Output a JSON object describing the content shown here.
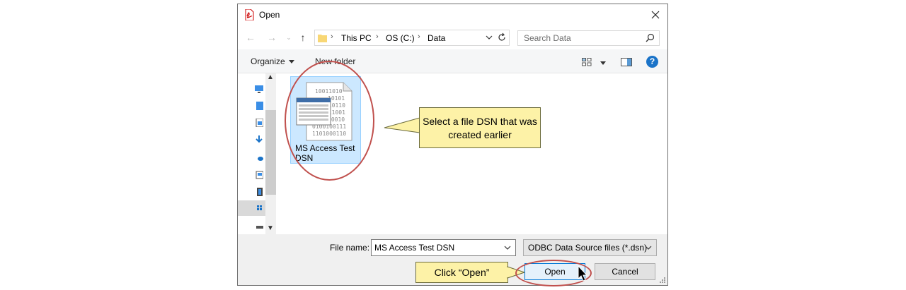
{
  "window": {
    "title": "Open"
  },
  "address": {
    "crumbs": [
      "This PC",
      "OS (C:)",
      "Data"
    ]
  },
  "search": {
    "placeholder": "Search Data"
  },
  "toolbar": {
    "organize_label": "Organize",
    "new_folder_label": "New folder"
  },
  "files": [
    {
      "name": "MS Access Test DSN",
      "type": "file DSN"
    }
  ],
  "file_icon": {
    "binary_lines": [
      "10011010",
      "10101",
      "110110",
      "011001",
      "00010",
      "0100100111",
      "1101000110"
    ]
  },
  "annotations": {
    "select_callout": "Select a file DSN that was created earlier",
    "open_callout": "Click “Open”",
    "highlight_color": "#c0504d",
    "callout_color": "#fdf2a7"
  },
  "bottom": {
    "file_name_label": "File name:",
    "file_name_value": "MS Access Test DSN",
    "filter_value": "ODBC Data Source files (*.dsn)",
    "open_label": "Open",
    "cancel_label": "Cancel"
  },
  "colors": {
    "accent": "#0078d7",
    "selection": "#cce8ff",
    "help": "#1a73c8"
  }
}
